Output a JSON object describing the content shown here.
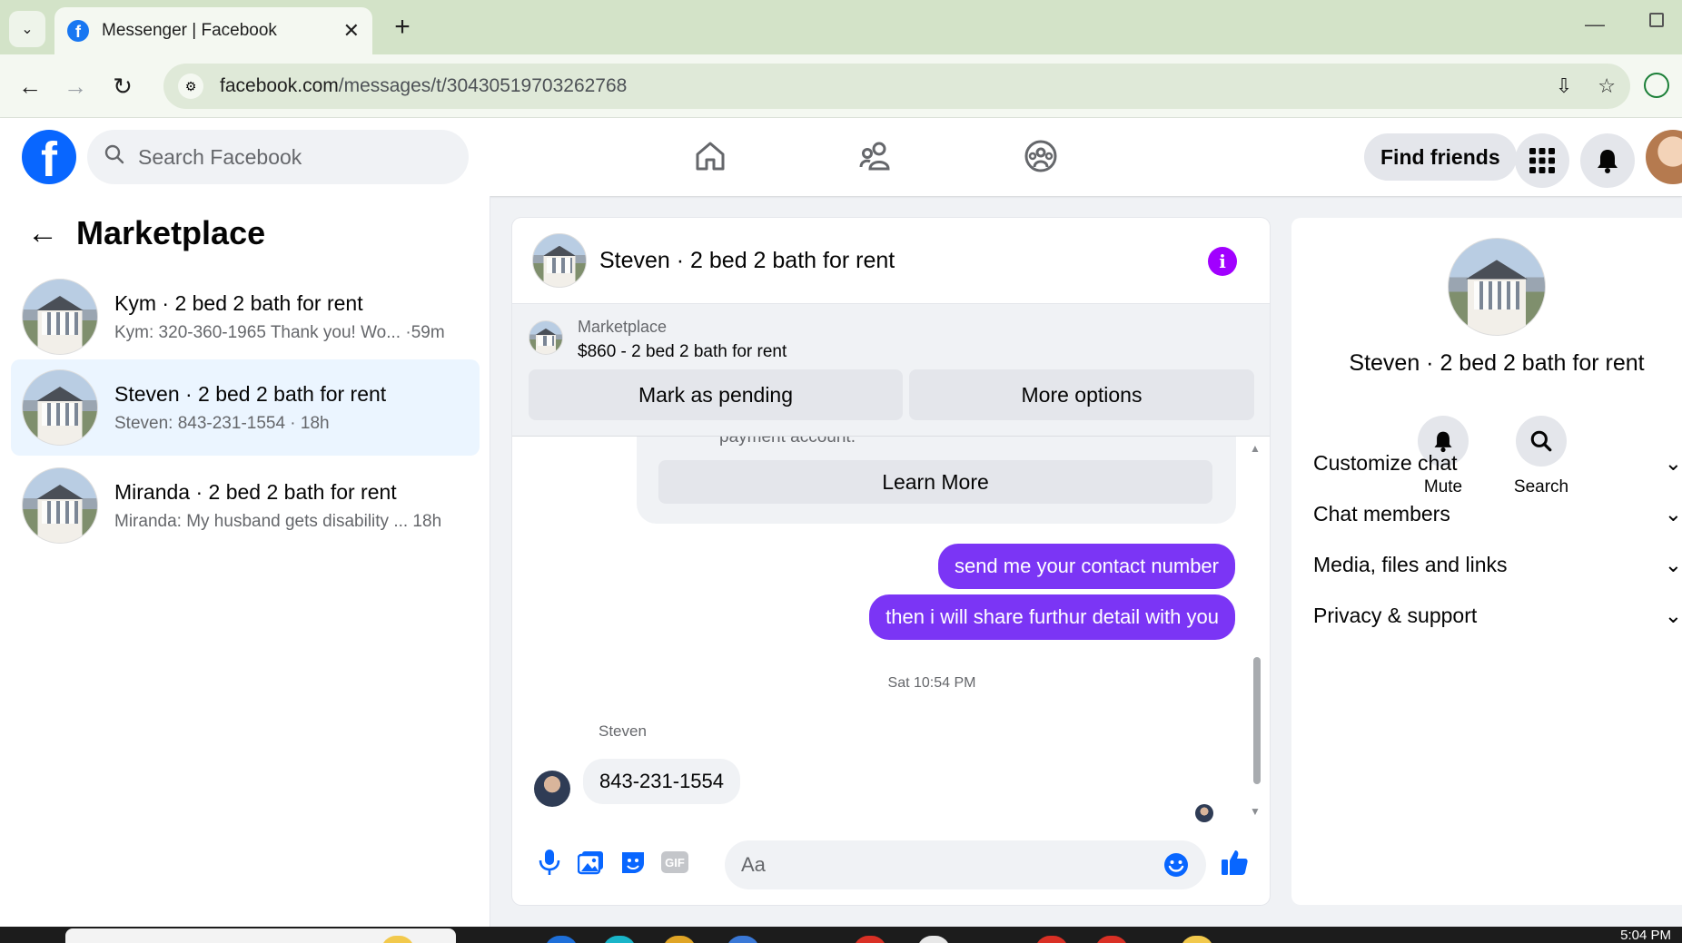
{
  "browser": {
    "tab_title": "Messenger | Facebook",
    "url_domain": "facebook.com",
    "url_path": "/messages/t/30430519703262768",
    "new_tab": "+",
    "close": "✕"
  },
  "header": {
    "logo_letter": "f",
    "search_placeholder": "Search Facebook",
    "find_friends_label": "Find friends"
  },
  "sidebar": {
    "title": "Marketplace",
    "conversations": [
      {
        "name": "Kym · 2 bed 2 bath for rent",
        "snippet": "Kym: 320-360-1965 Thank you! Wo... ·59m",
        "active": false
      },
      {
        "name": "Steven · 2 bed 2 bath for rent",
        "snippet": "Steven: 843-231-1554 · 18h",
        "active": true
      },
      {
        "name": "Miranda · 2 bed 2 bath for rent",
        "snippet": "Miranda: My husband gets disability ... 18h",
        "active": false
      }
    ]
  },
  "chat": {
    "title": "Steven · 2 bed 2 bath for rent",
    "banner": {
      "label": "Marketplace",
      "listing": "$860 - 2 bed 2 bath for rent",
      "mark_pending_label": "Mark as pending",
      "more_options_label": "More options"
    },
    "system_card": {
      "text": "payment account.",
      "learn_more_label": "Learn More"
    },
    "outgoing": [
      "send me your contact number",
      "then i will share furthur detail with you"
    ],
    "timestamp": "Sat 10:54 PM",
    "incoming_sender": "Steven",
    "incoming_text": "843-231-1554",
    "composer_placeholder": "Aa"
  },
  "details": {
    "title": "Steven · 2 bed 2 bath for rent",
    "actions": [
      {
        "label": "Mute",
        "icon": "bell-icon"
      },
      {
        "label": "Search",
        "icon": "search-icon"
      }
    ],
    "sections": [
      "Customize chat",
      "Chat members",
      "Media, files and links",
      "Privacy & support"
    ]
  },
  "taskbar": {
    "time": "5:04 PM"
  },
  "colors": {
    "facebook_blue": "#0866ff",
    "outgoing_bubble": "#7b35f5",
    "info_purple": "#a100ff",
    "active_row": "#ebf5ff"
  }
}
